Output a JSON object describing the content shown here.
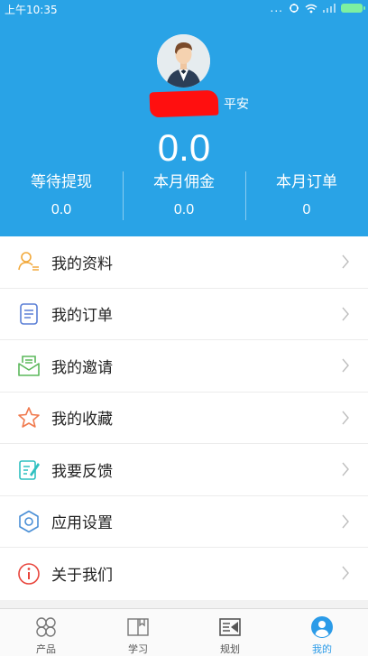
{
  "status_bar": {
    "time": "上午10:35",
    "dots": "...",
    "battery_color": "#7df0a1"
  },
  "profile": {
    "name_suffix": "平安",
    "balance": "0.0",
    "avatar_icon": "waiter-avatar-icon"
  },
  "stats": [
    {
      "label": "等待提现",
      "value": "0.0"
    },
    {
      "label": "本月佣金",
      "value": "0.0"
    },
    {
      "label": "本月订单",
      "value": "0"
    }
  ],
  "menu": {
    "items": [
      {
        "label": "我的资料",
        "icon": "profile-icon",
        "color": "#f2a93b"
      },
      {
        "label": "我的订单",
        "icon": "order-icon",
        "color": "#5a7fd6"
      },
      {
        "label": "我的邀请",
        "icon": "invite-icon",
        "color": "#5cb85c"
      },
      {
        "label": "我的收藏",
        "icon": "star-icon",
        "color": "#f07a4e"
      },
      {
        "label": "我要反馈",
        "icon": "feedback-icon",
        "color": "#2fc0c0"
      },
      {
        "label": "应用设置",
        "icon": "settings-icon",
        "color": "#4a8fd6"
      },
      {
        "label": "关于我们",
        "icon": "info-icon",
        "color": "#e8453c"
      }
    ]
  },
  "tabbar": {
    "tabs": [
      {
        "label": "产品",
        "icon": "products-icon",
        "active": false
      },
      {
        "label": "学习",
        "icon": "study-icon",
        "active": false
      },
      {
        "label": "规划",
        "icon": "plan-icon",
        "active": false
      },
      {
        "label": "我的",
        "icon": "me-icon",
        "active": true
      }
    ]
  },
  "colors": {
    "header_bg": "#29a3e6",
    "accent": "#2b9be8"
  }
}
